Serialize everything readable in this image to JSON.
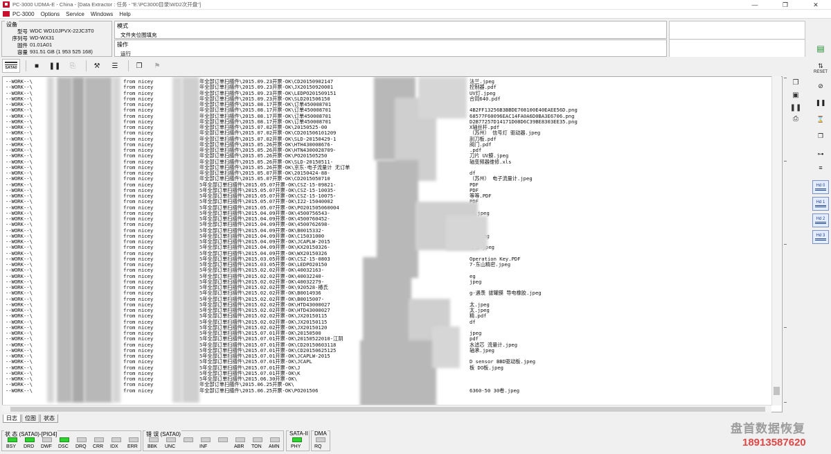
{
  "window": {
    "title": "PC-3000 UDMA-E - China - [Data Extractor : 任务 - \"E:\\PC3000目录\\WD2次开盘\"]",
    "controls": [
      "—",
      "❐",
      "✕"
    ]
  },
  "menu": [
    "PC-3000",
    "Options",
    "Service",
    "Windows",
    "Help"
  ],
  "device": {
    "title": "设备",
    "fields": [
      {
        "key": "型号",
        "value": "WDC WD10JPVX-22JC3T0"
      },
      {
        "key": "序列号",
        "value": "WD-WX31"
      },
      {
        "key": "固件",
        "value": "01.01A01"
      },
      {
        "key": "容量",
        "value": "931.51 GB (1 953 525 168)"
      }
    ]
  },
  "mode": {
    "label": "模式",
    "value": "文件夹位图填充"
  },
  "operation": {
    "label": "操作",
    "value": "运行"
  },
  "toolbar": {
    "sata_label": "SATA0"
  },
  "log": {
    "lines": [
      {
        "a": "--WORK--\\",
        "b": "from nicey",
        "c": "年全部订单扫描件\\2015.09.23开票-OK\\CD20150902147",
        "d": "",
        "e": "法兰.jpeg"
      },
      {
        "a": "--WORK--\\",
        "b": "from nicey",
        "c": "年全部订单扫描件\\2015.09.23开票-OK\\JX20150920001",
        "d": "",
        "e": "控制器.pdf"
      },
      {
        "a": "--WORK--\\",
        "b": "from nicey",
        "c": "年全部订单扫描件\\2015.09.23开票-OK\\LEDPO201509151",
        "d": "",
        "e": "UV灯.jpeg"
      },
      {
        "a": "--WORK--\\",
        "b": "from nicey",
        "c": "年全部订单扫描件\\2015.09.23开票-OK\\SLD201506150",
        "d": "",
        "e": "合同640.pdf"
      },
      {
        "a": "--WORK--\\",
        "b": "from nicey",
        "c": "年全部订单扫描件\\2015.08.17开票-OK\\订单450008701",
        "d": "",
        "e": ""
      },
      {
        "a": "--WORK--\\",
        "b": "from nicey",
        "c": "年全部订单扫描件\\2015.08.17开票-OK\\订单450008701",
        "d": "",
        "e": "4B2FF13256B3BBDE708100E40EAEE56D.png"
      },
      {
        "a": "--WORK--\\",
        "b": "from nicey",
        "c": "年全部订单扫描件\\2015.08.17开票-OK\\订单450008701",
        "d": "",
        "e": "68577F60096EAC14FA0A6D0BA3E6706.png"
      },
      {
        "a": "--WORK--\\",
        "b": "from nicey",
        "c": "年全部订单扫描件\\2015.08.17开票-OK\\订单450008701",
        "d": "",
        "e": "D2B77257D14171D08D6C39BE8303EE35.png"
      },
      {
        "a": "--WORK--\\",
        "b": "from nicey",
        "c": "年全部订单扫描件\\2015.07.02开票-OK\\20150525-00",
        "d": "",
        "e": "X轴丝杆.pdf"
      },
      {
        "a": "--WORK--\\",
        "b": "from nicey",
        "c": "年全部订单扫描件\\2015.07.02开票-OK\\CD201506101209",
        "d": "",
        "e": "（苏州） 信号灯 驱动器.jpeg"
      },
      {
        "a": "--WORK--\\",
        "b": "from nicey",
        "c": "年全部订单扫描件\\2015.07.02开票-OK\\SLD-20150429-1",
        "d": "",
        "e": "刮刀板.pdf"
      },
      {
        "a": "--WORK--\\",
        "b": "from nicey",
        "c": "年全部订单扫描件\\2015.05.26开票-OK\\HTH430008676-",
        "d": "",
        "e": "阀门.pdf"
      },
      {
        "a": "--WORK--\\",
        "b": "from nicey",
        "c": "年全部订单扫描件\\2015.05.26开票-OK\\HTN4300028709-",
        "d": "",
        "e": ".pdf"
      },
      {
        "a": "--WORK--\\",
        "b": "from nicey",
        "c": "年全部订单扫描件\\2015.05.26开票-OK\\PO201505250",
        "d": "",
        "e": "刀片 UV膜.jpeg"
      },
      {
        "a": "--WORK--\\",
        "b": "from nicey",
        "c": "年全部订单扫描件\\2015.05.26开票-OK\\SLD-20150511-",
        "d": "",
        "e": "轴变频器维修.xls"
      },
      {
        "a": "--WORK--\\",
        "b": "from nicey",
        "c": "年全部订单扫描件\\2015.05.26开票-OK\\京东-电子流量计 无订单",
        "d": "",
        "e": ""
      },
      {
        "a": "--WORK--\\",
        "b": "from nicey",
        "c": "年全部订单扫描件\\2015.05.07开票-OK\\20150424-88-",
        "d": "",
        "e": "df"
      },
      {
        "a": "--WORK--\\",
        "b": "from nicey",
        "c": "年全部订单扫描件\\2015.05.07开票-OK\\CD2015050710",
        "d": "",
        "e": "（苏州） 电子流量计.jpeg"
      },
      {
        "a": "--WORK--\\",
        "b": "from nicey",
        "c": "5年全部订单扫描件\\2015.05.07开票-OK\\CSZ-15-09821-",
        "d": "",
        "e": "PDF"
      },
      {
        "a": "--WORK--\\",
        "b": "from nicey",
        "c": "5年全部订单扫描件\\2015.05.07开票-OK\\CSZ-15-10035-",
        "d": "",
        "e": "PDF"
      },
      {
        "a": "--WORK--\\",
        "b": "from nicey",
        "c": "5年全部订单扫描件\\2015.05.07开票-OK\\CSZ-15-10075-",
        "d": "",
        "e": "等等.PDF"
      },
      {
        "a": "--WORK--\\",
        "b": "from nicey",
        "c": "5年全部订单扫描件\\2015.05.07开票-OK\\I22-15040002",
        "d": "",
        "e": "PDF"
      },
      {
        "a": "--WORK--\\",
        "b": "from nicey",
        "c": "5年全部订单扫描件\\2015.05.07开票-OK\\PO201505060004",
        "d": "",
        "e": "eg"
      },
      {
        "a": "--WORK--\\",
        "b": "from nicey",
        "c": "5年全部订单扫描件\\2015.04.09开票-OK\\4500756543-",
        "d": "",
        "e": "圈.jpeg"
      },
      {
        "a": "--WORK--\\",
        "b": "from nicey",
        "c": "5年全部订单扫描件\\2015.04.09开票-OK\\4500760452-",
        "d": "",
        "e": ""
      },
      {
        "a": "--WORK--\\",
        "b": "from nicey",
        "c": "5年全部订单扫描件\\2015.04.09开票-OK\\4500762698-",
        "d": "",
        "e": ""
      },
      {
        "a": "--WORK--\\",
        "b": "from nicey",
        "c": "5年全部订单扫描件\\2015.04.09开票-OK\\B0015332-",
        "d": "",
        "e": ""
      },
      {
        "a": "--WORK--\\",
        "b": "from nicey",
        "c": "5年全部订单扫描件\\2015.04.09开票-OK\\C15031000",
        "d": "",
        "e": "器.jpeg"
      },
      {
        "a": "--WORK--\\",
        "b": "from nicey",
        "c": "5年全部订单扫描件\\2015.04.09开票-OK\\JCAPLW-2015",
        "d": "",
        "e": ""
      },
      {
        "a": "--WORK--\\",
        "b": "from nicey",
        "c": "5年全部订单扫描件\\2015.04.09开票-OK\\KX20150326-",
        "d": "",
        "e": "灯板.jpeg"
      },
      {
        "a": "--WORK--\\",
        "b": "from nicey",
        "c": "5年全部订单扫描件\\2015.04.09开票-OK\\WX20150326",
        "d": "",
        "e": ""
      },
      {
        "a": "--WORK--\\",
        "b": "from nicey",
        "c": "5年全部订单扫描件\\2015.03.05开票-OK\\CSZ-15-0803",
        "d": "",
        "e": "Operation Key.PDF"
      },
      {
        "a": "--WORK--\\",
        "b": "from nicey",
        "c": "5年全部订单扫描件\\2015.03.05开票-OK\\LEDPO20150",
        "d": "",
        "e": "7-东山精密.jpeg"
      },
      {
        "a": "--WORK--\\",
        "b": "from nicey",
        "c": "5年全部订单扫描件\\2015.02.02开票-OK\\40032163-",
        "d": "",
        "e": ""
      },
      {
        "a": "--WORK--\\",
        "b": "from nicey",
        "c": "5年全部订单扫描件\\2015.02.02开票-OK\\40032240-",
        "d": "",
        "e": "eg"
      },
      {
        "a": "--WORK--\\",
        "b": "from nicey",
        "c": "5年全部订单扫描件\\2015.02.02开票-OK\\40032279-",
        "d": "",
        "e": "jpeg"
      },
      {
        "a": "--WORK--\\",
        "b": "from nicey",
        "c": "5年全部订单扫描件\\2015.02.02开票-OK\\920528-椿氏",
        "d": "",
        "e": ""
      },
      {
        "a": "--WORK--\\",
        "b": "from nicey",
        "c": "5年全部订单扫描件\\2015.02.02开票-OK\\B0014936",
        "d": "",
        "e": "g-遇羡 拔罐膜 导电橡胶.jpeg"
      },
      {
        "a": "--WORK--\\",
        "b": "from nicey",
        "c": "5年全部订单扫描件\\2015.02.02开票-OK\\B0015007-",
        "d": "",
        "e": ""
      },
      {
        "a": "--WORK--\\",
        "b": "from nicey",
        "c": "5年全部订单扫描件\\2015.02.02开票-OK\\HTD43000027",
        "d": "",
        "e": "太.jpeg"
      },
      {
        "a": "--WORK--\\",
        "b": "from nicey",
        "c": "5年全部订单扫描件\\2015.02.02开票-OK\\HTD43000027",
        "d": "",
        "e": "太.jpeg"
      },
      {
        "a": "--WORK--\\",
        "b": "from nicey",
        "c": "5年全部订单扫描件\\2015.02.02开票-OK\\JX20150115",
        "d": "",
        "e": "精.pdf"
      },
      {
        "a": "--WORK--\\",
        "b": "from nicey",
        "c": "5年全部订单扫描件\\2015.02.02开票-OK\\JX20150115",
        "d": "",
        "e": "df"
      },
      {
        "a": "--WORK--\\",
        "b": "from nicey",
        "c": "5年全部订单扫描件\\2015.02.02开票-OK\\JX20150120",
        "d": "",
        "e": ""
      },
      {
        "a": "--WORK--\\",
        "b": "from nicey",
        "c": "5年全部订单扫描件\\2015.07.01开票-OK\\20150500",
        "d": "",
        "e": "jpeg"
      },
      {
        "a": "--WORK--\\",
        "b": "from nicey",
        "c": "5年全部订单扫描件\\2015.07.01开票-OK\\20150522010-江阴",
        "d": "",
        "e": "pdf"
      },
      {
        "a": "--WORK--\\",
        "b": "from nicey",
        "c": "5年全部订单扫描件\\2015.07.01开票-OK\\CD20150603118",
        "d": "",
        "e": "水滤芯 流量计.jpeg"
      },
      {
        "a": "--WORK--\\",
        "b": "from nicey",
        "c": "5年全部订单扫描件\\2015.07.01开票-OK\\CD20150625125",
        "d": "",
        "e": "轴承.jpeg"
      },
      {
        "a": "--WORK--\\",
        "b": "from nicey",
        "c": "5年全部订单扫描件\\2015.07.01开票-OK\\JCAPLW-2015",
        "d": "",
        "e": ""
      },
      {
        "a": "--WORK--\\",
        "b": "from nicey",
        "c": "5年全部订单扫描件\\2015.07.01开票-OK\\JCAPL",
        "d": "",
        "e": "D sensor BBD驱动板.jpeg"
      },
      {
        "a": "--WORK--\\",
        "b": "from nicey",
        "c": "5年全部订单扫描件\\2015.07.01开票-OK\\J",
        "d": "",
        "e": "板 DO板.jpeg"
      },
      {
        "a": "--WORK--\\",
        "b": "from nicey",
        "c": "5年全部订单扫描件\\2015.07.01开票-OK\\K",
        "d": "",
        "e": ""
      },
      {
        "a": "--WORK--\\",
        "b": "from nicey",
        "c": "5年全部订单扫描件\\2015.06.30开票-OK\\",
        "d": "",
        "e": ""
      },
      {
        "a": "--WORK--\\",
        "b": "from nicey",
        "c": "年全部订单扫描件\\2015.06.25开票-OK\\",
        "d": "",
        "e": ""
      },
      {
        "a": "--WORK--\\",
        "b": "from nicey",
        "c": "年全部订单扫描件\\2015.06.25开票-OK\\PO201506",
        "d": "",
        "e": "6360-50 30卷.jpeg"
      }
    ]
  },
  "tabs": [
    "日志",
    "位图",
    "状态"
  ],
  "status": {
    "state": {
      "title": "状 态 (SATA0)-[PIO4]",
      "items": [
        {
          "label": "BSY",
          "on": true
        },
        {
          "label": "DRD",
          "on": true
        },
        {
          "label": "DWF",
          "on": false
        },
        {
          "label": "DSC",
          "on": true
        },
        {
          "label": "DRQ",
          "on": false
        },
        {
          "label": "CRR",
          "on": false
        },
        {
          "label": "IDX",
          "on": false
        },
        {
          "label": "ERR",
          "on": false
        }
      ]
    },
    "error": {
      "title": "错 误 (SATA0)",
      "items": [
        {
          "label": "BBK",
          "on": false
        },
        {
          "label": "UNC",
          "on": false
        },
        {
          "label": "",
          "on": false
        },
        {
          "label": "INF",
          "on": false
        },
        {
          "label": "",
          "on": false
        },
        {
          "label": "ABR",
          "on": false
        },
        {
          "label": "TON",
          "on": false
        },
        {
          "label": "AMN",
          "on": false
        }
      ]
    },
    "sata": {
      "title": "SATA-II",
      "items": [
        {
          "label": "PHY",
          "on": true
        }
      ]
    },
    "dma": {
      "title": "DMA",
      "items": [
        {
          "label": "RQ",
          "on": false
        }
      ]
    }
  },
  "right_panel": {
    "reset_label": "RESET",
    "hd_buttons": [
      "Hd 0",
      "Hd 1",
      "Hd 2",
      "Hd 3"
    ]
  },
  "watermark": {
    "line1": "盘首数据恢复",
    "line2": "18913587620"
  }
}
